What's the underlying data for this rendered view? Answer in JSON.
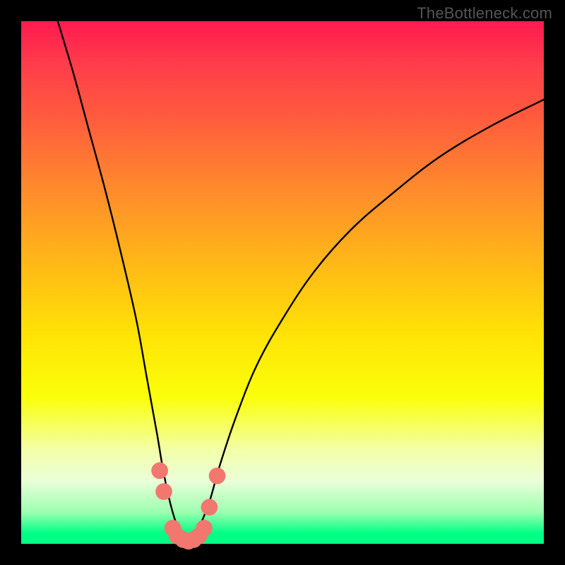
{
  "watermark": "TheBottleneck.com",
  "chart_data": {
    "type": "line",
    "title": "",
    "xlabel": "",
    "ylabel": "",
    "xlim": [
      0,
      100
    ],
    "ylim": [
      0,
      100
    ],
    "grid": false,
    "series": [
      {
        "name": "bottleneck-curve",
        "x": [
          7,
          10,
          13,
          16,
          19,
          22,
          24,
          26,
          27,
          28,
          29,
          30,
          31,
          32,
          33,
          34,
          36,
          38,
          41,
          45,
          50,
          56,
          63,
          71,
          80,
          90,
          100
        ],
        "values": [
          100,
          90,
          79,
          68,
          56,
          43,
          32,
          21,
          15,
          10,
          6,
          3,
          1,
          0,
          1,
          3,
          8,
          15,
          24,
          34,
          43,
          52,
          60,
          67,
          74,
          80,
          85
        ]
      }
    ],
    "markers": {
      "name": "highlight-dots",
      "color": "#f2776e",
      "radius_pct": 1.6,
      "points": [
        {
          "x": 26.5,
          "y": 14
        },
        {
          "x": 27.3,
          "y": 10
        },
        {
          "x": 29.0,
          "y": 3
        },
        {
          "x": 29.8,
          "y": 1.5
        },
        {
          "x": 31.0,
          "y": 0.8
        },
        {
          "x": 32.0,
          "y": 0.5
        },
        {
          "x": 33.0,
          "y": 0.8
        },
        {
          "x": 34.0,
          "y": 1.5
        },
        {
          "x": 35.0,
          "y": 3
        },
        {
          "x": 36.0,
          "y": 7
        },
        {
          "x": 37.5,
          "y": 13
        }
      ]
    }
  }
}
